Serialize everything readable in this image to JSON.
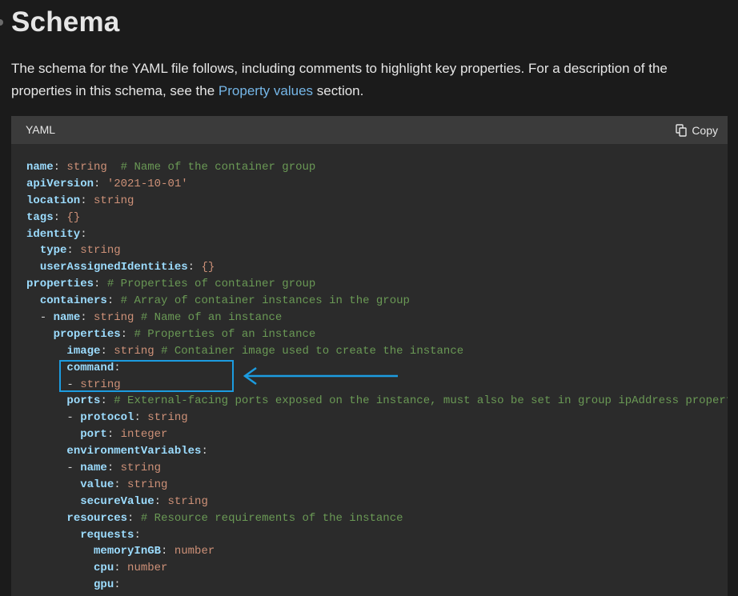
{
  "page": {
    "title": "Schema",
    "intro_before_link": "The schema for the YAML file follows, including comments to highlight key properties. For a description of the properties in this schema, see the ",
    "intro_link": "Property values",
    "intro_after_link": " section."
  },
  "code_block": {
    "language": "YAML",
    "copy_label": "Copy",
    "lines": [
      [
        {
          "t": "name",
          "c": "key"
        },
        {
          "t": ": ",
          "c": "pun"
        },
        {
          "t": "string",
          "c": "val"
        },
        {
          "t": "  ",
          "c": "pun"
        },
        {
          "t": "# Name of the container group",
          "c": "com"
        }
      ],
      [
        {
          "t": "apiVersion",
          "c": "key"
        },
        {
          "t": ": ",
          "c": "pun"
        },
        {
          "t": "'2021-10-01'",
          "c": "val"
        }
      ],
      [
        {
          "t": "location",
          "c": "key"
        },
        {
          "t": ": ",
          "c": "pun"
        },
        {
          "t": "string",
          "c": "val"
        }
      ],
      [
        {
          "t": "tags",
          "c": "key"
        },
        {
          "t": ": ",
          "c": "pun"
        },
        {
          "t": "{}",
          "c": "val"
        }
      ],
      [
        {
          "t": "identity",
          "c": "key"
        },
        {
          "t": ":",
          "c": "pun"
        }
      ],
      [
        {
          "t": "  ",
          "c": "pun"
        },
        {
          "t": "type",
          "c": "key"
        },
        {
          "t": ": ",
          "c": "pun"
        },
        {
          "t": "string",
          "c": "val"
        }
      ],
      [
        {
          "t": "  ",
          "c": "pun"
        },
        {
          "t": "userAssignedIdentities",
          "c": "key"
        },
        {
          "t": ": ",
          "c": "pun"
        },
        {
          "t": "{}",
          "c": "val"
        }
      ],
      [
        {
          "t": "properties",
          "c": "key"
        },
        {
          "t": ": ",
          "c": "pun"
        },
        {
          "t": "# Properties of container group",
          "c": "com"
        }
      ],
      [
        {
          "t": "  ",
          "c": "pun"
        },
        {
          "t": "containers",
          "c": "key"
        },
        {
          "t": ": ",
          "c": "pun"
        },
        {
          "t": "# Array of container instances in the group",
          "c": "com"
        }
      ],
      [
        {
          "t": "  - ",
          "c": "pun"
        },
        {
          "t": "name",
          "c": "key"
        },
        {
          "t": ": ",
          "c": "pun"
        },
        {
          "t": "string",
          "c": "val"
        },
        {
          "t": " ",
          "c": "pun"
        },
        {
          "t": "# Name of an instance",
          "c": "com"
        }
      ],
      [
        {
          "t": "    ",
          "c": "pun"
        },
        {
          "t": "properties",
          "c": "key"
        },
        {
          "t": ": ",
          "c": "pun"
        },
        {
          "t": "# Properties of an instance",
          "c": "com"
        }
      ],
      [
        {
          "t": "      ",
          "c": "pun"
        },
        {
          "t": "image",
          "c": "key"
        },
        {
          "t": ": ",
          "c": "pun"
        },
        {
          "t": "string",
          "c": "val"
        },
        {
          "t": " ",
          "c": "pun"
        },
        {
          "t": "# Container image used to create the instance",
          "c": "com"
        }
      ],
      [
        {
          "t": "      ",
          "c": "pun"
        },
        {
          "t": "command",
          "c": "key"
        },
        {
          "t": ":",
          "c": "pun"
        }
      ],
      [
        {
          "t": "      - ",
          "c": "pun"
        },
        {
          "t": "string",
          "c": "val"
        }
      ],
      [
        {
          "t": "      ",
          "c": "pun"
        },
        {
          "t": "ports",
          "c": "key"
        },
        {
          "t": ": ",
          "c": "pun"
        },
        {
          "t": "# External-facing ports exposed on the instance, must also be set in group ipAddress property",
          "c": "com"
        }
      ],
      [
        {
          "t": "      - ",
          "c": "pun"
        },
        {
          "t": "protocol",
          "c": "key"
        },
        {
          "t": ": ",
          "c": "pun"
        },
        {
          "t": "string",
          "c": "val"
        }
      ],
      [
        {
          "t": "        ",
          "c": "pun"
        },
        {
          "t": "port",
          "c": "key"
        },
        {
          "t": ": ",
          "c": "pun"
        },
        {
          "t": "integer",
          "c": "val"
        }
      ],
      [
        {
          "t": "      ",
          "c": "pun"
        },
        {
          "t": "environmentVariables",
          "c": "key"
        },
        {
          "t": ":",
          "c": "pun"
        }
      ],
      [
        {
          "t": "      - ",
          "c": "pun"
        },
        {
          "t": "name",
          "c": "key"
        },
        {
          "t": ": ",
          "c": "pun"
        },
        {
          "t": "string",
          "c": "val"
        }
      ],
      [
        {
          "t": "        ",
          "c": "pun"
        },
        {
          "t": "value",
          "c": "key"
        },
        {
          "t": ": ",
          "c": "pun"
        },
        {
          "t": "string",
          "c": "val"
        }
      ],
      [
        {
          "t": "        ",
          "c": "pun"
        },
        {
          "t": "secureValue",
          "c": "key"
        },
        {
          "t": ": ",
          "c": "pun"
        },
        {
          "t": "string",
          "c": "val"
        }
      ],
      [
        {
          "t": "      ",
          "c": "pun"
        },
        {
          "t": "resources",
          "c": "key"
        },
        {
          "t": ": ",
          "c": "pun"
        },
        {
          "t": "# Resource requirements of the instance",
          "c": "com"
        }
      ],
      [
        {
          "t": "        ",
          "c": "pun"
        },
        {
          "t": "requests",
          "c": "key"
        },
        {
          "t": ":",
          "c": "pun"
        }
      ],
      [
        {
          "t": "          ",
          "c": "pun"
        },
        {
          "t": "memoryInGB",
          "c": "key"
        },
        {
          "t": ": ",
          "c": "pun"
        },
        {
          "t": "number",
          "c": "val"
        }
      ],
      [
        {
          "t": "          ",
          "c": "pun"
        },
        {
          "t": "cpu",
          "c": "key"
        },
        {
          "t": ": ",
          "c": "pun"
        },
        {
          "t": "number",
          "c": "val"
        }
      ],
      [
        {
          "t": "          ",
          "c": "pun"
        },
        {
          "t": "gpu",
          "c": "key"
        },
        {
          "t": ":",
          "c": "pun"
        }
      ]
    ]
  },
  "annotation": {
    "highlight_color": "#1c9ce0",
    "highlighted_lines": [
      "command:",
      "- string"
    ]
  },
  "colors": {
    "background": "#1b1b1b",
    "code_background": "#2b2b2b",
    "code_header": "#3b3b3b",
    "link": "#75b6e7",
    "yaml_key": "#9cdcfe",
    "yaml_value": "#ce9178",
    "yaml_comment": "#6a9955"
  }
}
